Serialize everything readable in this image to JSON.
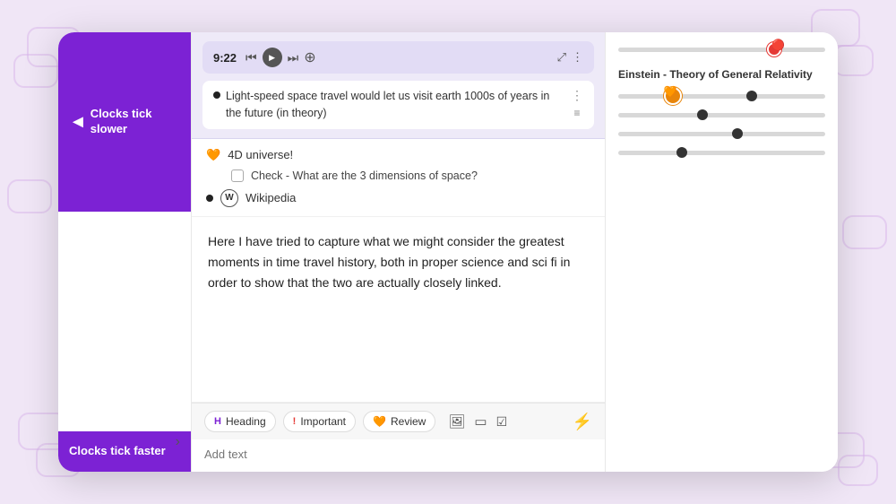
{
  "sidebar": {
    "top_title": "Clocks tick slower",
    "bottom_title": "Clocks tick faster",
    "arrow_icon": "◄",
    "chevron_icon": "›"
  },
  "audio_player": {
    "time": "9:22",
    "text": "Light-speed space travel would let us visit earth 1000s of years in the future (in theory)"
  },
  "middle": {
    "emoji_label": "4D universe!",
    "emoji": "🧡",
    "checkbox_text": "Check - What are the 3 dimensions of space?",
    "wiki_text": "Wikipedia"
  },
  "paragraph": "Here I have tried to capture what we might consider the greatest moments in time travel history, both in proper science and sci fi in order to show that the two are actually closely linked.",
  "right_panel": {
    "section_label": "Einstein - Theory of General Relativity"
  },
  "toolbar": {
    "heading_label": "Heading",
    "important_label": "Important",
    "review_label": "Review",
    "review_emoji": "🧡",
    "add_text_placeholder": "Add text"
  }
}
